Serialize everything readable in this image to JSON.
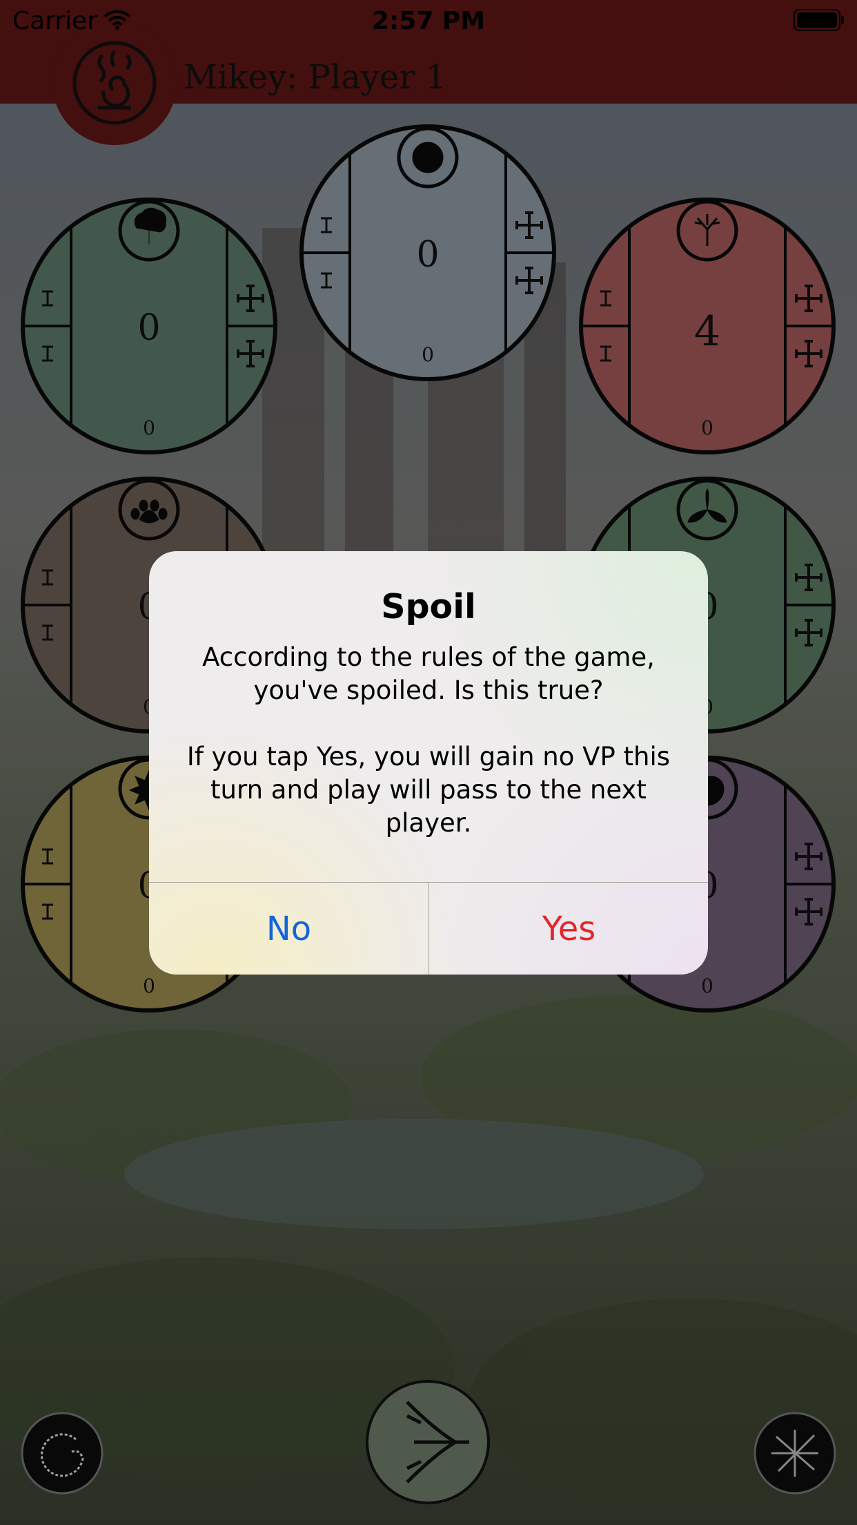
{
  "status_bar": {
    "carrier": "Carrier",
    "time": "2:57 PM"
  },
  "header": {
    "title": "Mikey: Player 1"
  },
  "cards": [
    {
      "name": "tree-card",
      "color": "#5d7a6a",
      "icon": "tree-icon",
      "value": "0",
      "small_value": "0"
    },
    {
      "name": "moon-card",
      "color": "#8d9aa3",
      "icon": "moon-icon",
      "value": "0",
      "small_value": "0"
    },
    {
      "name": "branch-card",
      "color": "#a45959",
      "icon": "bare-tree-icon",
      "value": "4",
      "small_value": "0"
    },
    {
      "name": "paw-card",
      "color": "#6b5f55",
      "icon": "paw-icon",
      "value": "0",
      "small_value": "0"
    },
    {
      "name": "leaf-card",
      "color": "#5a7a61",
      "icon": "leaf-icon",
      "value": "0",
      "small_value": "0"
    },
    {
      "name": "sun-card",
      "color": "#9b8c4e",
      "icon": "sun-icon",
      "value": "0",
      "small_value": "0"
    },
    {
      "name": "spiral-card",
      "color": "#6f5d75",
      "icon": "spiral-icon",
      "value": "0",
      "small_value": "0"
    }
  ],
  "alert": {
    "title": "Spoil",
    "message": "According to the rules of the game, you've spoiled. Is this true?\n\nIf you tap Yes, you will gain no VP this turn and play will pass to the next player.",
    "no_label": "No",
    "yes_label": "Yes"
  },
  "colors": {
    "header": "#5f1516",
    "no_button": "#1565d8",
    "yes_button": "#e3262b"
  }
}
